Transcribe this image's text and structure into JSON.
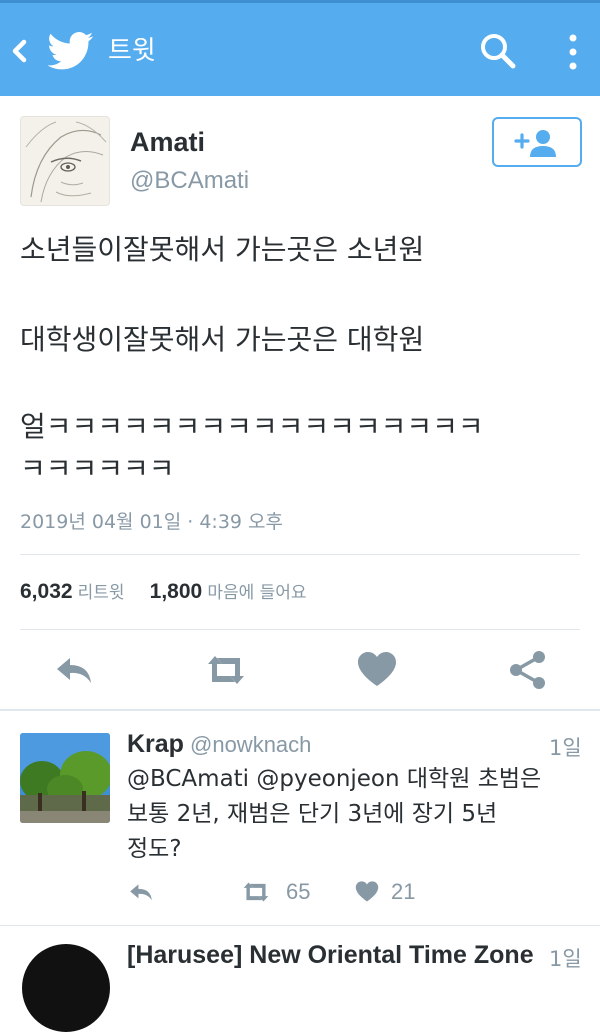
{
  "header": {
    "title": "트윗",
    "bg_color": "#55acee"
  },
  "tweet": {
    "author_name": "Amati",
    "author_handle": "@BCAmati",
    "lines": [
      "소년들이잘못해서 가는곳은 소년원",
      "대학생이잘못해서 가는곳은 대학원",
      "얼ㅋㅋㅋㅋㅋㅋㅋㅋㅋㅋㅋㅋㅋㅋㅋㅋㅋ",
      "ㅋㅋㅋㅋㅋㅋ"
    ],
    "timestamp": "2019년 04월 01일 · 4:39 오후",
    "retweet_count": "6,032",
    "retweet_label": "리트윗",
    "like_count": "1,800",
    "like_label": "마음에 들어요"
  },
  "replies": [
    {
      "name": "Krap",
      "handle": "@nowknach",
      "time": "1일",
      "lines": [
        "@BCAmati @pyeonjeon 대학원 초범은",
        "보통 2년, 재범은 단기 3년에 장기 5년",
        "정도?"
      ],
      "retweets": "65",
      "likes": "21"
    },
    {
      "name": "[Harusee] New Oriental Time Zone",
      "time": "1일"
    }
  ],
  "icons": {
    "back": "back-chevron-icon",
    "logo": "twitter-bird-icon",
    "search": "search-icon",
    "more": "more-vertical-icon",
    "follow": "follow-user-icon",
    "reply": "reply-icon",
    "retweet": "retweet-icon",
    "like": "heart-icon",
    "share": "share-icon"
  }
}
